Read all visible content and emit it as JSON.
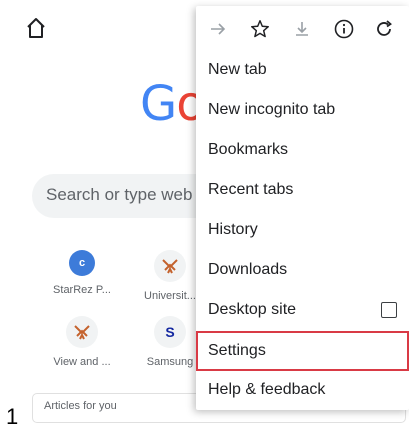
{
  "page": {
    "step_number": "1",
    "logo_text_g": "G",
    "logo_text_o": "o",
    "search_placeholder": "Search or type web ad",
    "tiles": [
      {
        "label": "StarRez P...",
        "icon_letter": "c",
        "icon": "starrez-icon"
      },
      {
        "label": "Universit...",
        "icon": "university-logo-icon"
      },
      {
        "label": "View and ...",
        "icon": "university-logo-icon"
      },
      {
        "label": "Samsung",
        "icon_letter": "S",
        "icon": "samsung-icon"
      }
    ],
    "articles_label": "Articles for you"
  },
  "menu": {
    "icons": [
      {
        "name": "forward-icon",
        "glyph": "→"
      },
      {
        "name": "bookmark-star-icon",
        "glyph": "☆"
      },
      {
        "name": "download-icon",
        "glyph": "⤓"
      },
      {
        "name": "info-icon",
        "glyph": "ⓘ"
      },
      {
        "name": "refresh-icon",
        "glyph": "↻"
      }
    ],
    "items": [
      {
        "label": "New tab"
      },
      {
        "label": "New incognito tab"
      },
      {
        "label": "Bookmarks"
      },
      {
        "label": "Recent tabs"
      },
      {
        "label": "History"
      },
      {
        "label": "Downloads"
      },
      {
        "label": "Desktop site",
        "checkbox": false
      },
      {
        "label": "Settings",
        "highlighted": true
      },
      {
        "label": "Help & feedback"
      }
    ]
  },
  "colors": {
    "google_blue": "#4285f4",
    "google_red": "#ea4335",
    "highlight": "#d93a45"
  }
}
